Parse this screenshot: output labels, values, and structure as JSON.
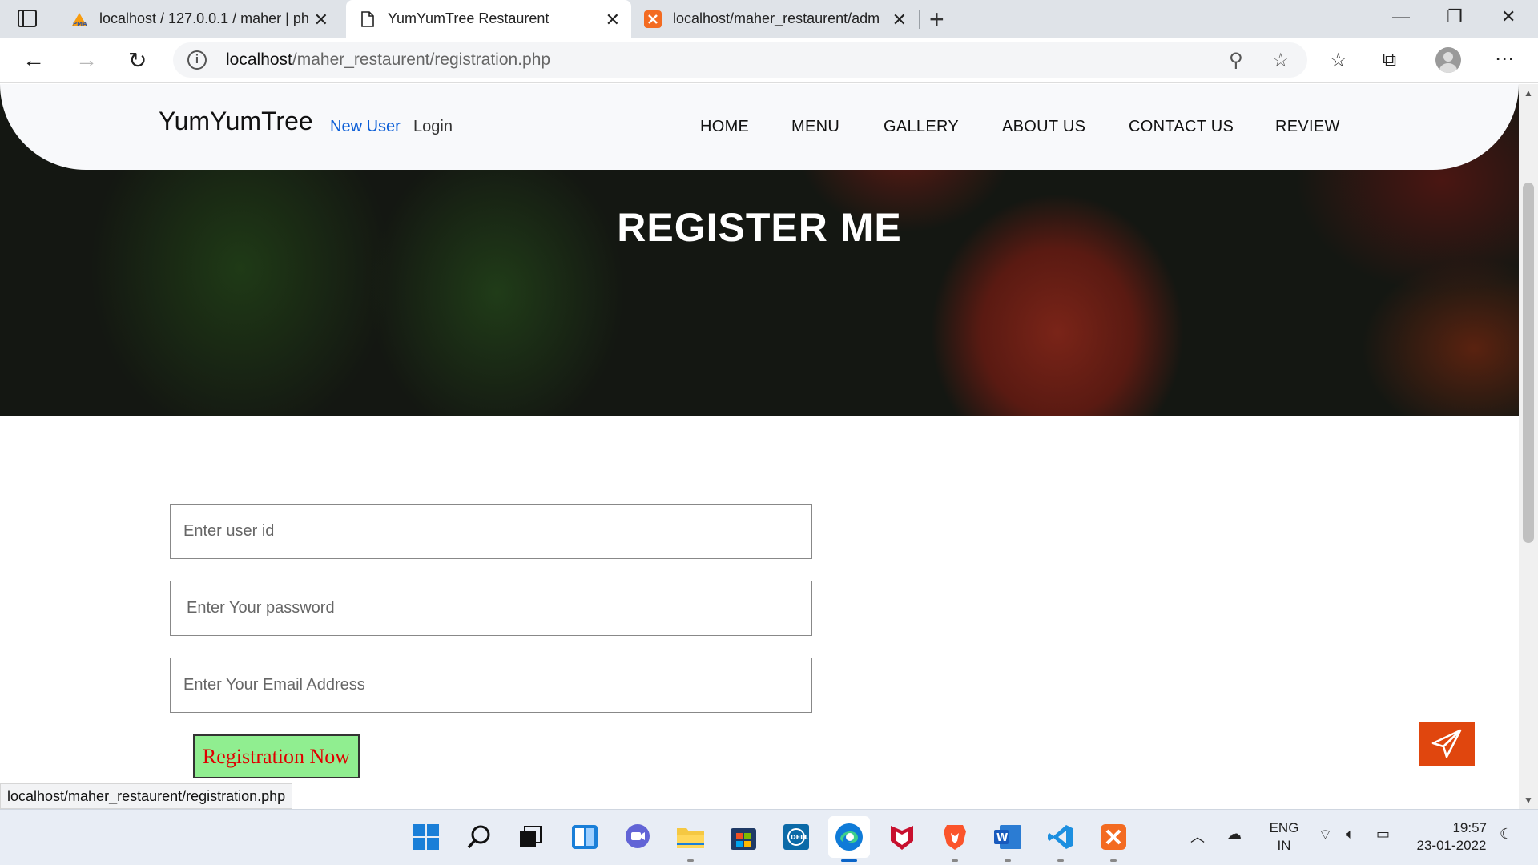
{
  "browser": {
    "tabs": [
      {
        "title": "localhost / 127.0.0.1 / maher | ph",
        "favicon": "phpmyadmin-icon",
        "active": false
      },
      {
        "title": "YumYumTree Restaurent",
        "favicon": "page-icon",
        "active": true
      },
      {
        "title": "localhost/maher_restaurent/adm",
        "favicon": "xampp-icon",
        "active": false
      }
    ],
    "url_host": "localhost",
    "url_path": "/maher_restaurent/registration.php"
  },
  "site": {
    "brand": "YumYumTree",
    "new_user": "New User",
    "login": "Login",
    "nav": [
      "HOME",
      "MENU",
      "GALLERY",
      "ABOUT US",
      "CONTACT US",
      "REVIEW"
    ],
    "hero_title": "REGISTER ME"
  },
  "form": {
    "user_id_placeholder": "Enter user id",
    "password_placeholder": "Enter Your password",
    "email_placeholder": "Enter Your Email Address",
    "submit_label": "Registration Now"
  },
  "status_url": "localhost/maher_restaurent/registration.php",
  "taskbar": {
    "lang_top": "ENG",
    "lang_bottom": "IN",
    "time": "19:57",
    "date": "23-01-2022"
  },
  "colors": {
    "accent_blue": "#0b5ed7",
    "submit_bg": "#90ee90",
    "submit_text": "#e00000",
    "send_button": "#e0460e"
  }
}
